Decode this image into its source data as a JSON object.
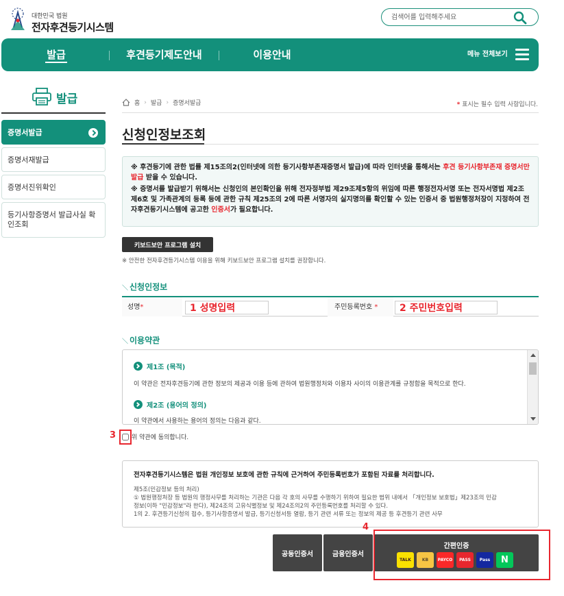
{
  "header": {
    "logo_small": "대한민국 법원",
    "logo_big": "전자후견등기시스템",
    "search_placeholder": "검색어를 입력해주세요",
    "search_icon": "search-icon"
  },
  "gnb": {
    "items": [
      "발급",
      "후견등기제도안내",
      "이용안내"
    ],
    "all_menu": "메뉴 전체보기",
    "accent": "#13907b"
  },
  "lnb": {
    "title": "발급",
    "items": [
      "증명서발급",
      "증명서재발급",
      "증명서진위확인",
      "등기사항증명서 발급사실 확인조회"
    ]
  },
  "breadcrumb": [
    "홈",
    "발급",
    "증명서발급"
  ],
  "required_note": {
    "star": "*",
    "text": "표시는 필수 입력 사항입니다."
  },
  "page_title": "신청인정보조회",
  "notice": {
    "line1_a": "※ 후견등기에 관한 법률 제15조의2(인터넷에 의한 등기사항부존재증명서 발급)에 따라 인터넷을 통해서는 ",
    "line1_red": "후견 등기사항부존재",
    "line2_red": "증명서만 발급",
    "line2_b": " 받을 수 있습니다.",
    "line3": "※ 증명서를 발급받기 위해서는 신청인의 본인확인을 위해 전자정부법 제29조제5항의 위임에 따른 행정전자서명 또는 전자서명법 제2조제6호 및 가족관계의 등록 등에 관한 규칙 제25조의 2에 따른 서명자의 실지명의를 확인할 수 있는 인증서 중 법원행정처장이 지정하여 전자후견등기시스템에 공고한 ",
    "line3_red": "인증서",
    "line3_end": "가 필요합니다."
  },
  "keyboard": {
    "button": "키보드보안 프로그램 설치",
    "note": "※ 안전한 전자후견등기시스템 이용을 위해 키보드보안 프로그램 설치를 권장합니다."
  },
  "applicant": {
    "section": "신청인정보",
    "name_label": "성명",
    "name_value": "1 성명입력",
    "rrn_label": "주민등록번호",
    "rrn_value": "2 주민번호입력",
    "star": "*"
  },
  "terms": {
    "section": "이용약관",
    "art1_title": "제1조 (목적)",
    "art1_text": "이 약관은 전자후견등기에 관한 정보의 제공과 이용 등에 관하여 법원행정처와 이용자 사이의 이용관계를 규정함을 목적으로 한다.",
    "art2_title": "제2조 (용어의 정의)",
    "art2_text": "이 약관에서 사용하는 용어의 정의는 다음과 같다."
  },
  "agree": {
    "num": "3",
    "text": "위 약관에 동의합니다."
  },
  "privacy": {
    "heading": "전자후견등기시스템은 법원 개인정보 보호에 관한 규칙에 근거하여 주민등록번호가 포함된 자료를 처리합니다.",
    "l1": "제5조(민감정보 등의 처리)",
    "l2": "① 법원행정처장 등 법원의 행정사무를 처리하는 기관은 다음 각 호의 사무를 수행하기 위하여 필요한 범위 내에서 「개인정보 보호법」제23조의 민감",
    "l3": "정보(이하 \"민감정보\"라 한다), 제24조의 고유식별정보 및 제24조의2의 주민등록번호를 처리할 수 있다.",
    "l4": "1의 2. 후견등기신청의 접수, 등기사항증명서 발급, 등기신청서등 열람, 등기 관련 서류 또는 정보의 제공 등 후견등기 관련 사무"
  },
  "auth": {
    "num": "4",
    "joint_cert": "공동인증서",
    "finance_cert": "금융인증서",
    "simple_title": "간편인증",
    "providers": [
      {
        "label": "TALK",
        "bg": "#fae100",
        "fg": "#3c1e1e"
      },
      {
        "label": "KB",
        "bg": "#f6c544",
        "fg": "#5a4a2a"
      },
      {
        "label": "PAYCO",
        "bg": "#fa2828",
        "fg": "#ffffff"
      },
      {
        "label": "PASS",
        "bg": "#e8262e",
        "fg": "#ffffff"
      },
      {
        "label": "Pass",
        "bg": "#1428a0",
        "fg": "#ffffff"
      },
      {
        "label": "N",
        "bg": "#03c75a",
        "fg": "#ffffff"
      }
    ]
  }
}
